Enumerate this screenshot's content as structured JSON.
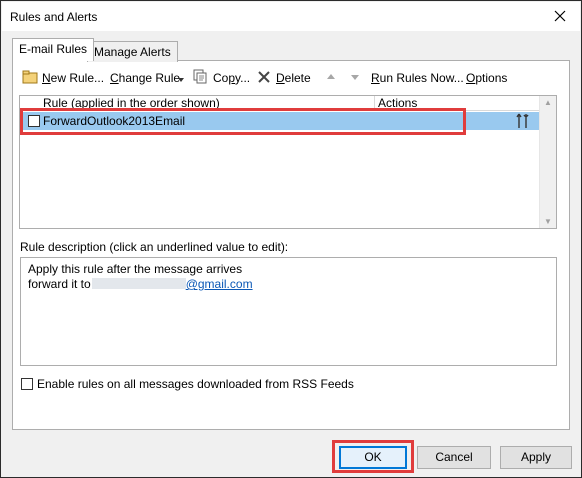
{
  "window": {
    "title": "Rules and Alerts",
    "close_icon": "close-icon"
  },
  "tabs": [
    {
      "label": "E-mail Rules",
      "active": true
    },
    {
      "label": "Manage Alerts",
      "active": false
    }
  ],
  "toolbar": {
    "new_rule": "New Rule...",
    "change_rule": "Change Rule",
    "copy": "Copy...",
    "delete": "Delete",
    "run_rules_now": "Run Rules Now...",
    "options": "Options",
    "icons": [
      "new-rule-icon",
      "dropdown-arrow-icon",
      "copy-icon",
      "delete-icon",
      "move-up-icon",
      "move-down-icon"
    ]
  },
  "rules_table": {
    "columns": [
      "Rule (applied in the order shown)",
      "Actions"
    ],
    "rows": [
      {
        "name": "ForwardOutlook2013Email",
        "checked": false,
        "selected": true,
        "action_icon": "forward-action-icon"
      }
    ]
  },
  "description": {
    "label": "Rule description (click an underlined value to edit):",
    "line1": "Apply this rule after the message arrives",
    "line2_prefix": "forward it to",
    "email_domain": "@gmail.com"
  },
  "rss_option": {
    "label": "Enable rules on all messages downloaded from RSS Feeds",
    "checked": false
  },
  "buttons": {
    "ok": "OK",
    "cancel": "Cancel",
    "apply": "Apply"
  },
  "colors": {
    "highlight": "#e03c3c",
    "selected_row": "#99c9ef",
    "link": "#0b58b6",
    "default_button_border": "#0078d7"
  }
}
